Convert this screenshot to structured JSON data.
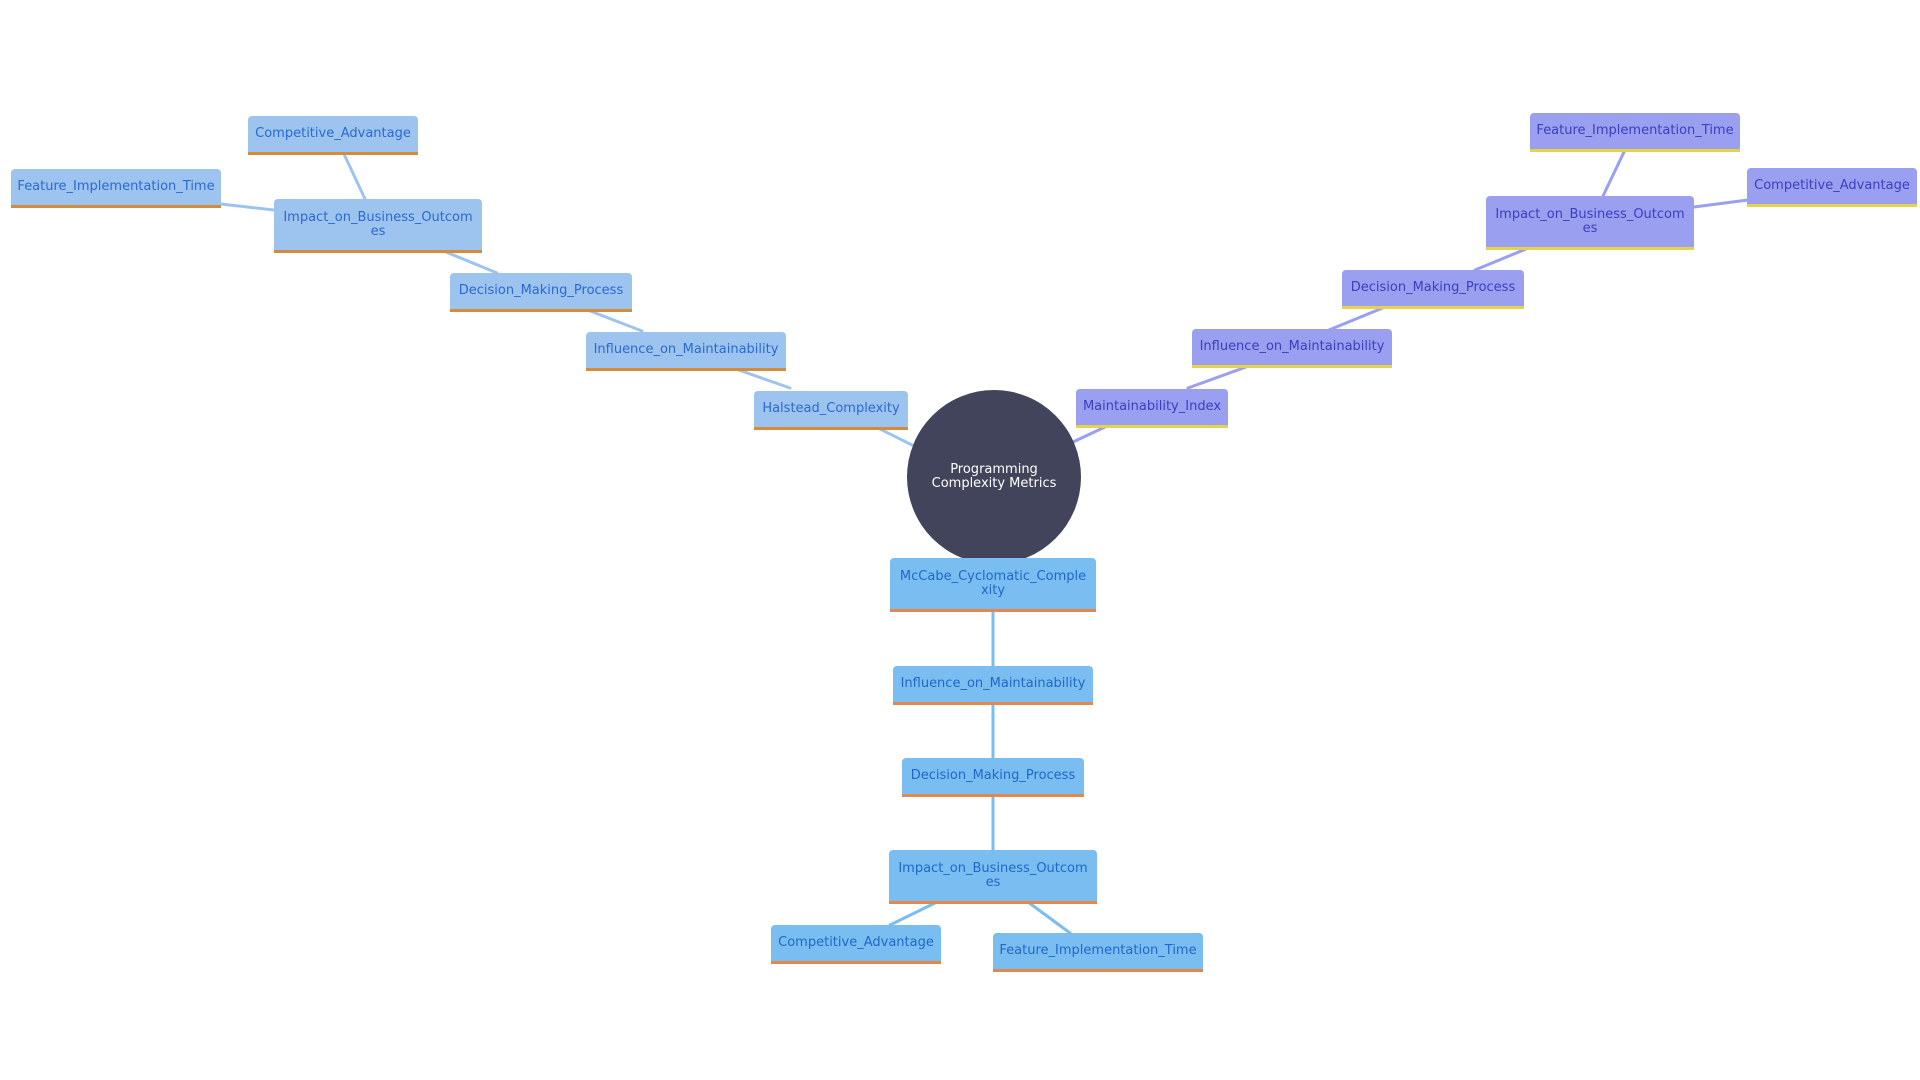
{
  "diagram": {
    "type": "mindmap",
    "root": {
      "label": "Programming Complexity Metrics"
    },
    "colors": {
      "root_fill": "#41445a",
      "root_text": "#ffffff",
      "left_branch": {
        "fill": "#9cc4ef",
        "text": "#2a6ad0",
        "underline": "#d68a3c",
        "edge": "#9cc4ef"
      },
      "right_branch": {
        "fill": "#9a9ff0",
        "text": "#3b3fc0",
        "underline": "#e3d44a",
        "edge": "#9a9ff0"
      },
      "down_branch": {
        "fill": "#7abdf0",
        "text": "#2069c8",
        "underline": "#e4874a",
        "edge": "#7abdf0"
      }
    },
    "branches": {
      "left": {
        "halstead": "Halstead_Complexity",
        "influence": "Influence_on_Maintainability",
        "decision": "Decision_Making_Process",
        "impact": "Impact_on_Business_Outcomes",
        "competitive": "Competitive_Advantage",
        "feature": "Feature_Implementation_Time"
      },
      "right": {
        "maintainability": "Maintainability_Index",
        "influence": "Influence_on_Maintainability",
        "decision": "Decision_Making_Process",
        "impact": "Impact_on_Business_Outcomes",
        "feature": "Feature_Implementation_Time",
        "competitive": "Competitive_Advantage"
      },
      "down": {
        "mccabe": "McCabe_Cyclomatic_Complexity",
        "influence": "Influence_on_Maintainability",
        "decision": "Decision_Making_Process",
        "impact": "Impact_on_Business_Outcomes",
        "competitive": "Competitive_Advantage",
        "feature": "Feature_Implementation_Time"
      }
    },
    "edges": [
      [
        "root",
        "left.halstead"
      ],
      [
        "left.halstead",
        "left.influence"
      ],
      [
        "left.influence",
        "left.decision"
      ],
      [
        "left.decision",
        "left.impact"
      ],
      [
        "left.impact",
        "left.competitive"
      ],
      [
        "left.impact",
        "left.feature"
      ],
      [
        "root",
        "right.maintainability"
      ],
      [
        "right.maintainability",
        "right.influence"
      ],
      [
        "right.influence",
        "right.decision"
      ],
      [
        "right.decision",
        "right.impact"
      ],
      [
        "right.impact",
        "right.feature"
      ],
      [
        "right.impact",
        "right.competitive"
      ],
      [
        "root",
        "down.mccabe"
      ],
      [
        "down.mccabe",
        "down.influence"
      ],
      [
        "down.influence",
        "down.decision"
      ],
      [
        "down.decision",
        "down.impact"
      ],
      [
        "down.impact",
        "down.competitive"
      ],
      [
        "down.impact",
        "down.feature"
      ]
    ]
  }
}
